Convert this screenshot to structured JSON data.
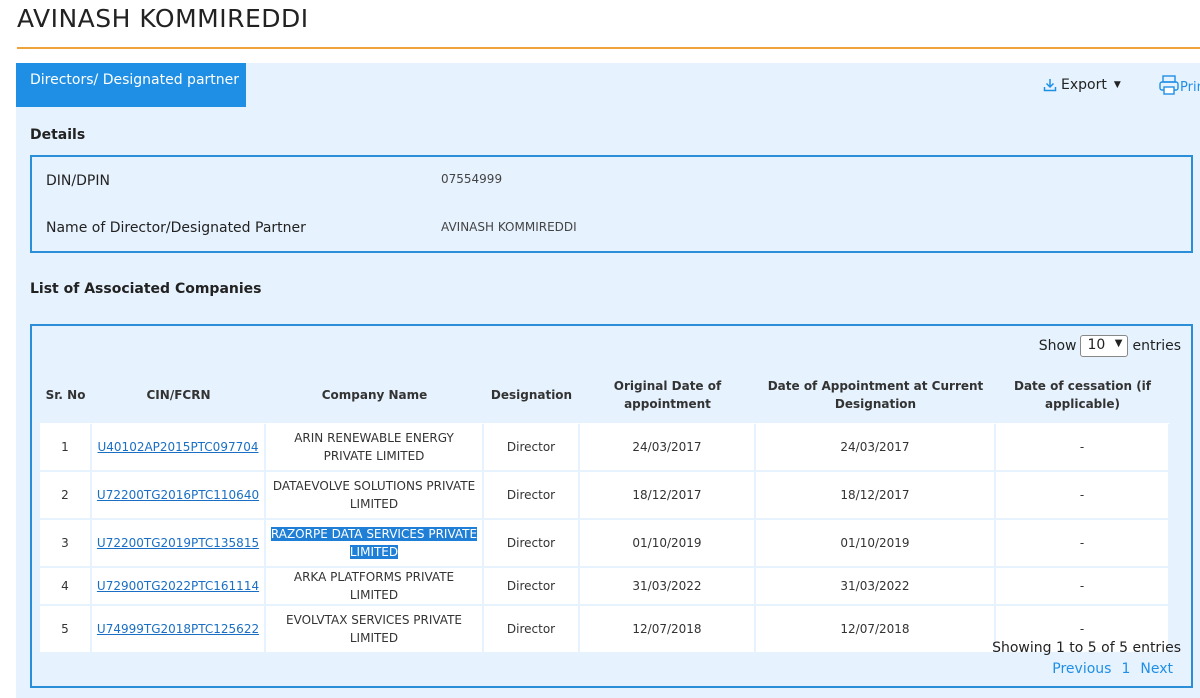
{
  "header": {
    "title": "AVINASH KOMMIREDDI"
  },
  "tabs": {
    "active_label": "Directors/ Designated partner"
  },
  "toolbar": {
    "export_label": "Export",
    "print_label": "Prin"
  },
  "details": {
    "heading": "Details",
    "din_label": "DIN/DPIN",
    "din_value": "07554999",
    "name_label": "Name of Director/Designated Partner",
    "name_value": "AVINASH KOMMIREDDI"
  },
  "companies": {
    "heading": "List of Associated Companies",
    "show_label": "Show",
    "page_size": "10",
    "entries_label": "entries",
    "columns": [
      "Sr. No",
      "CIN/FCRN",
      "Company Name",
      "Designation",
      "Original Date of appointment",
      "Date of Appointment at Current Designation",
      "Date of cessation (if applicable)"
    ],
    "rows": [
      {
        "sr": "1",
        "cin": "U40102AP2015PTC097704",
        "name": "ARIN RENEWABLE ENERGY PRIVATE LIMITED",
        "designation": "Director",
        "original_date": "24/03/2017",
        "current_date": "24/03/2017",
        "cessation": "-"
      },
      {
        "sr": "2",
        "cin": "U72200TG2016PTC110640",
        "name": "DATAEVOLVE SOLUTIONS PRIVATE LIMITED",
        "designation": "Director",
        "original_date": "18/12/2017",
        "current_date": "18/12/2017",
        "cessation": "-"
      },
      {
        "sr": "3",
        "cin": "U72200TG2019PTC135815",
        "name": "RAZORPE DATA SERVICES PRIVATE LIMITED",
        "designation": "Director",
        "original_date": "01/10/2019",
        "current_date": "01/10/2019",
        "cessation": "-"
      },
      {
        "sr": "4",
        "cin": "U72900TG2022PTC161114",
        "name": "ARKA PLATFORMS PRIVATE LIMITED",
        "designation": "Director",
        "original_date": "31/03/2022",
        "current_date": "31/03/2022",
        "cessation": "-"
      },
      {
        "sr": "5",
        "cin": "U74999TG2018PTC125622",
        "name": "EVOLVTAX SERVICES PRIVATE LIMITED",
        "designation": "Director",
        "original_date": "12/07/2018",
        "current_date": "12/07/2018",
        "cessation": "-"
      }
    ],
    "summary": "Showing 1 to 5 of 5 entries",
    "pagination": {
      "previous": "Previous",
      "page": "1",
      "next": "Next"
    }
  },
  "colors": {
    "accent": "#1f8fe6",
    "rule": "#f0a23b",
    "panel_bg": "#e6f2fd",
    "border": "#2a8fd8"
  }
}
